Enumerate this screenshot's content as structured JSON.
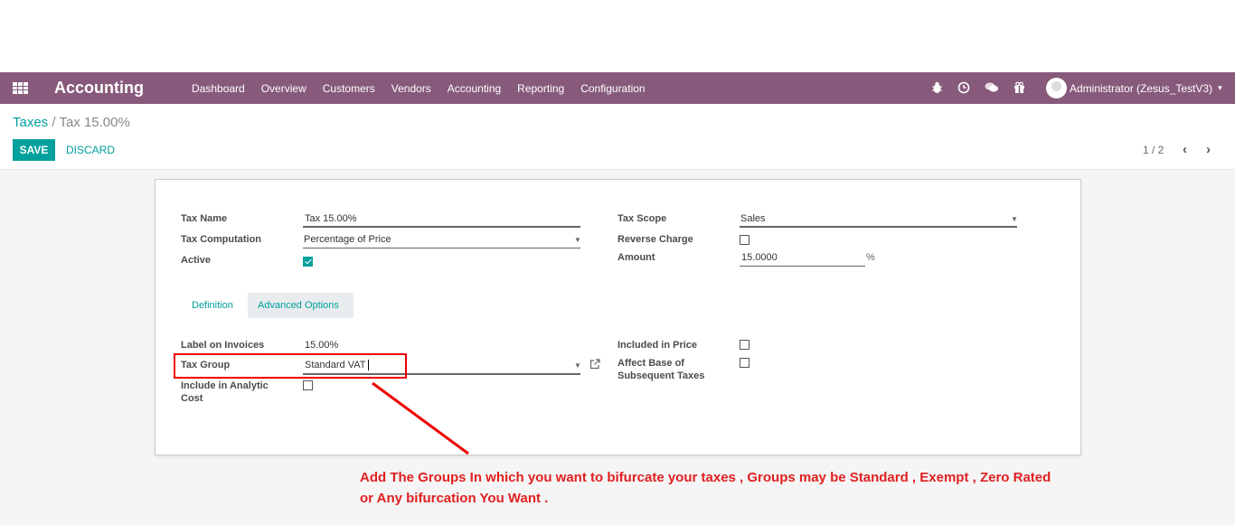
{
  "navbar": {
    "app_title": "Accounting",
    "menu": [
      "Dashboard",
      "Overview",
      "Customers",
      "Vendors",
      "Accounting",
      "Reporting",
      "Configuration"
    ],
    "icons": [
      "bug-icon",
      "clock-icon",
      "chat-icon",
      "gift-icon"
    ],
    "user": "Administrator (Zesus_TestV3)",
    "user_caret": "▾"
  },
  "breadcrumb": {
    "parent": "Taxes",
    "separator": "/",
    "current": "Tax 15.00%"
  },
  "controls": {
    "save": "SAVE",
    "discard": "DISCARD",
    "pager": "1 / 2",
    "prev": "‹",
    "next": "›"
  },
  "form": {
    "tax_name_label": "Tax Name",
    "tax_name_value": "Tax 15.00%",
    "tax_computation_label": "Tax Computation",
    "tax_computation_value": "Percentage of Price",
    "active_label": "Active",
    "active_checked": true,
    "tax_scope_label": "Tax Scope",
    "tax_scope_value": "Sales",
    "reverse_charge_label": "Reverse Charge",
    "amount_label": "Amount",
    "amount_value": "15.0000",
    "amount_unit": "%"
  },
  "tabs": [
    "Definition",
    "Advanced Options"
  ],
  "advanced": {
    "label_on_invoices_label": "Label on Invoices",
    "label_on_invoices_value": "15.00%",
    "tax_group_label": "Tax Group",
    "tax_group_value": "Standard VAT",
    "include_analytic_label": "Include in Analytic Cost",
    "included_in_price_label": "Included in Price",
    "affect_base_label": "Affect Base of Subsequent Taxes"
  },
  "annotation": {
    "text": "Add The Groups In which you want to bifurcate your taxes , Groups may be Standard , Exempt , Zero Rated or Any bifurcation You Want .",
    "color": "#e02020"
  },
  "colors": {
    "navbar": "#875a7b",
    "accent": "#00a09d"
  }
}
